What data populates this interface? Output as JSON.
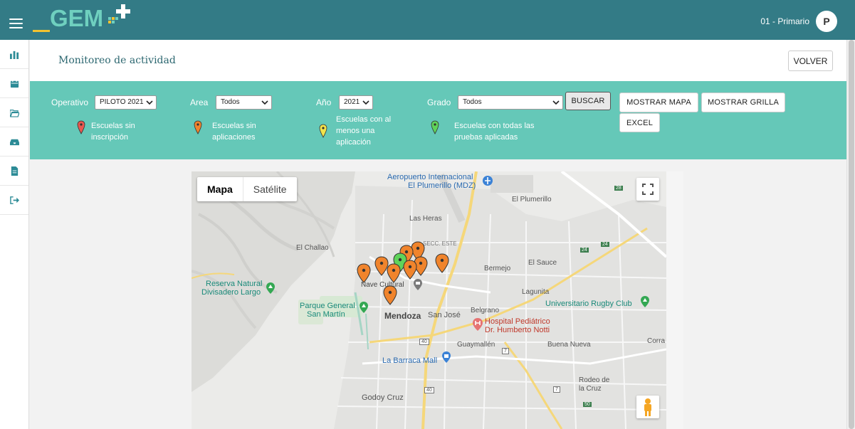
{
  "header": {
    "logo_text": "GEM",
    "user_label": "01 - Primario",
    "avatar_letter": "P",
    "colors": {
      "bar": "#337b86",
      "logo_teal": "#6fd0bf",
      "logo_yellow": "#f2c230"
    }
  },
  "sidebar": {
    "items": [
      {
        "icon": "chart-bars-icon"
      },
      {
        "icon": "calendar-icon"
      },
      {
        "icon": "folder-open-icon"
      },
      {
        "icon": "inbox-icon"
      },
      {
        "icon": "document-icon"
      },
      {
        "icon": "sign-out-icon"
      }
    ]
  },
  "page": {
    "title": "Monitoreo de actividad",
    "volver_label": "VOLVER"
  },
  "filters": {
    "operativo": {
      "label": "Operativo",
      "value": "PILOTO 2021"
    },
    "area": {
      "label": "Area",
      "value": "Todos"
    },
    "anio": {
      "label": "Año",
      "value": "2021"
    },
    "grado": {
      "label": "Grado",
      "value": "Todos"
    },
    "buscar_label": "BUSCAR",
    "mostrar_mapa_label": "MOSTRAR MAPA",
    "mostrar_grilla_label": "MOSTRAR GRILLA",
    "excel_label": "EXCEL",
    "panel_color": "#65c8b8"
  },
  "legend": [
    {
      "color": "#e8584f",
      "line1": "Escuelas sin",
      "line2": "inscripción",
      "line3": ""
    },
    {
      "color": "#f0842c",
      "line1": "Escuelas sin",
      "line2": "aplicaciones",
      "line3": ""
    },
    {
      "color": "#f2e34b",
      "line1": "Escuelas con al",
      "line2": "menos una",
      "line3": "aplicación"
    },
    {
      "color": "#5fd35a",
      "line1": "Escuelas con todas las",
      "line2": "pruebas aplicadas",
      "line3": ""
    }
  ],
  "map": {
    "tab_map": "Mapa",
    "tab_satellite": "Satélite",
    "labels": {
      "airport1": "Aeropuerto Internacional",
      "airport2": "El Plumerillo (MDZ)",
      "el_plumerillo": "El Plumerillo",
      "las_heras": "Las Heras",
      "secc_este": "SECC. ESTE",
      "el_challao": "El Challao",
      "reserva1": "Reserva Natural",
      "reserva2": "Divisadero Largo",
      "nave": "Nave Cultural",
      "parque1": "Parque General",
      "parque2": "San Martín",
      "mendoza": "Mendoza",
      "san_jose": "San José",
      "belgrano": "Belgrano",
      "bermejo": "Bermejo",
      "el_sauce": "El Sauce",
      "lagunita": "Lagunita",
      "rugby": "Universitario Rugby Club",
      "hospital1": "Hospital Pediátrico",
      "hospital2": "Dr. Humberto Notti",
      "guaymallen": "Guaymallén",
      "buena_nueva": "Buena Nueva",
      "corra": "Corra",
      "barraca": "La Barraca Mall",
      "rodeo1": "Rodeo de",
      "rodeo2": "la Cruz",
      "godoy": "Godoy Cruz",
      "r28": "28",
      "r24a": "24",
      "r24b": "24",
      "r40a": "40",
      "r40b": "40",
      "r7a": "7",
      "r7b": "7",
      "r50": "50"
    }
  }
}
